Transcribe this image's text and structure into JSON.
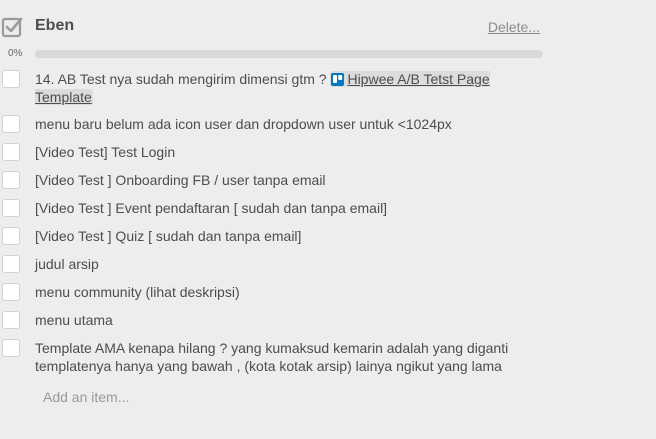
{
  "checklist": {
    "title": "Eben",
    "delete_label": "Delete...",
    "progress_label": "0%",
    "progress_fraction": 0,
    "add_item_placeholder": "Add an item...",
    "accent_color": "#5aac44",
    "items": [
      {
        "text": "14. AB Test nya sudah mengirim dimensi gtm ? ",
        "link_text": "Hipwee A/B Tetst Page Template",
        "link_icon": "trello-icon",
        "checked": false
      },
      {
        "text": "menu baru belum ada icon user dan dropdown user untuk <1024px",
        "checked": false
      },
      {
        "text": "[Video Test] Test Login",
        "checked": false
      },
      {
        "text": "[Video Test ] Onboarding FB / user tanpa email",
        "checked": false
      },
      {
        "text": "[Video Test ] Event pendaftaran [ sudah dan tanpa email]",
        "checked": false
      },
      {
        "text": "[Video Test ] Quiz [ sudah dan tanpa email]",
        "checked": false
      },
      {
        "text": "judul arsip",
        "checked": false
      },
      {
        "text": "menu community (lihat deskripsi)",
        "checked": false
      },
      {
        "text": "menu utama",
        "checked": false
      },
      {
        "text": "Template AMA kenapa hilang ? yang kumaksud kemarin adalah yang diganti templatenya hanya yang bawah , (kota kotak arsip) lainya ngikut yang lama",
        "checked": false
      }
    ]
  }
}
